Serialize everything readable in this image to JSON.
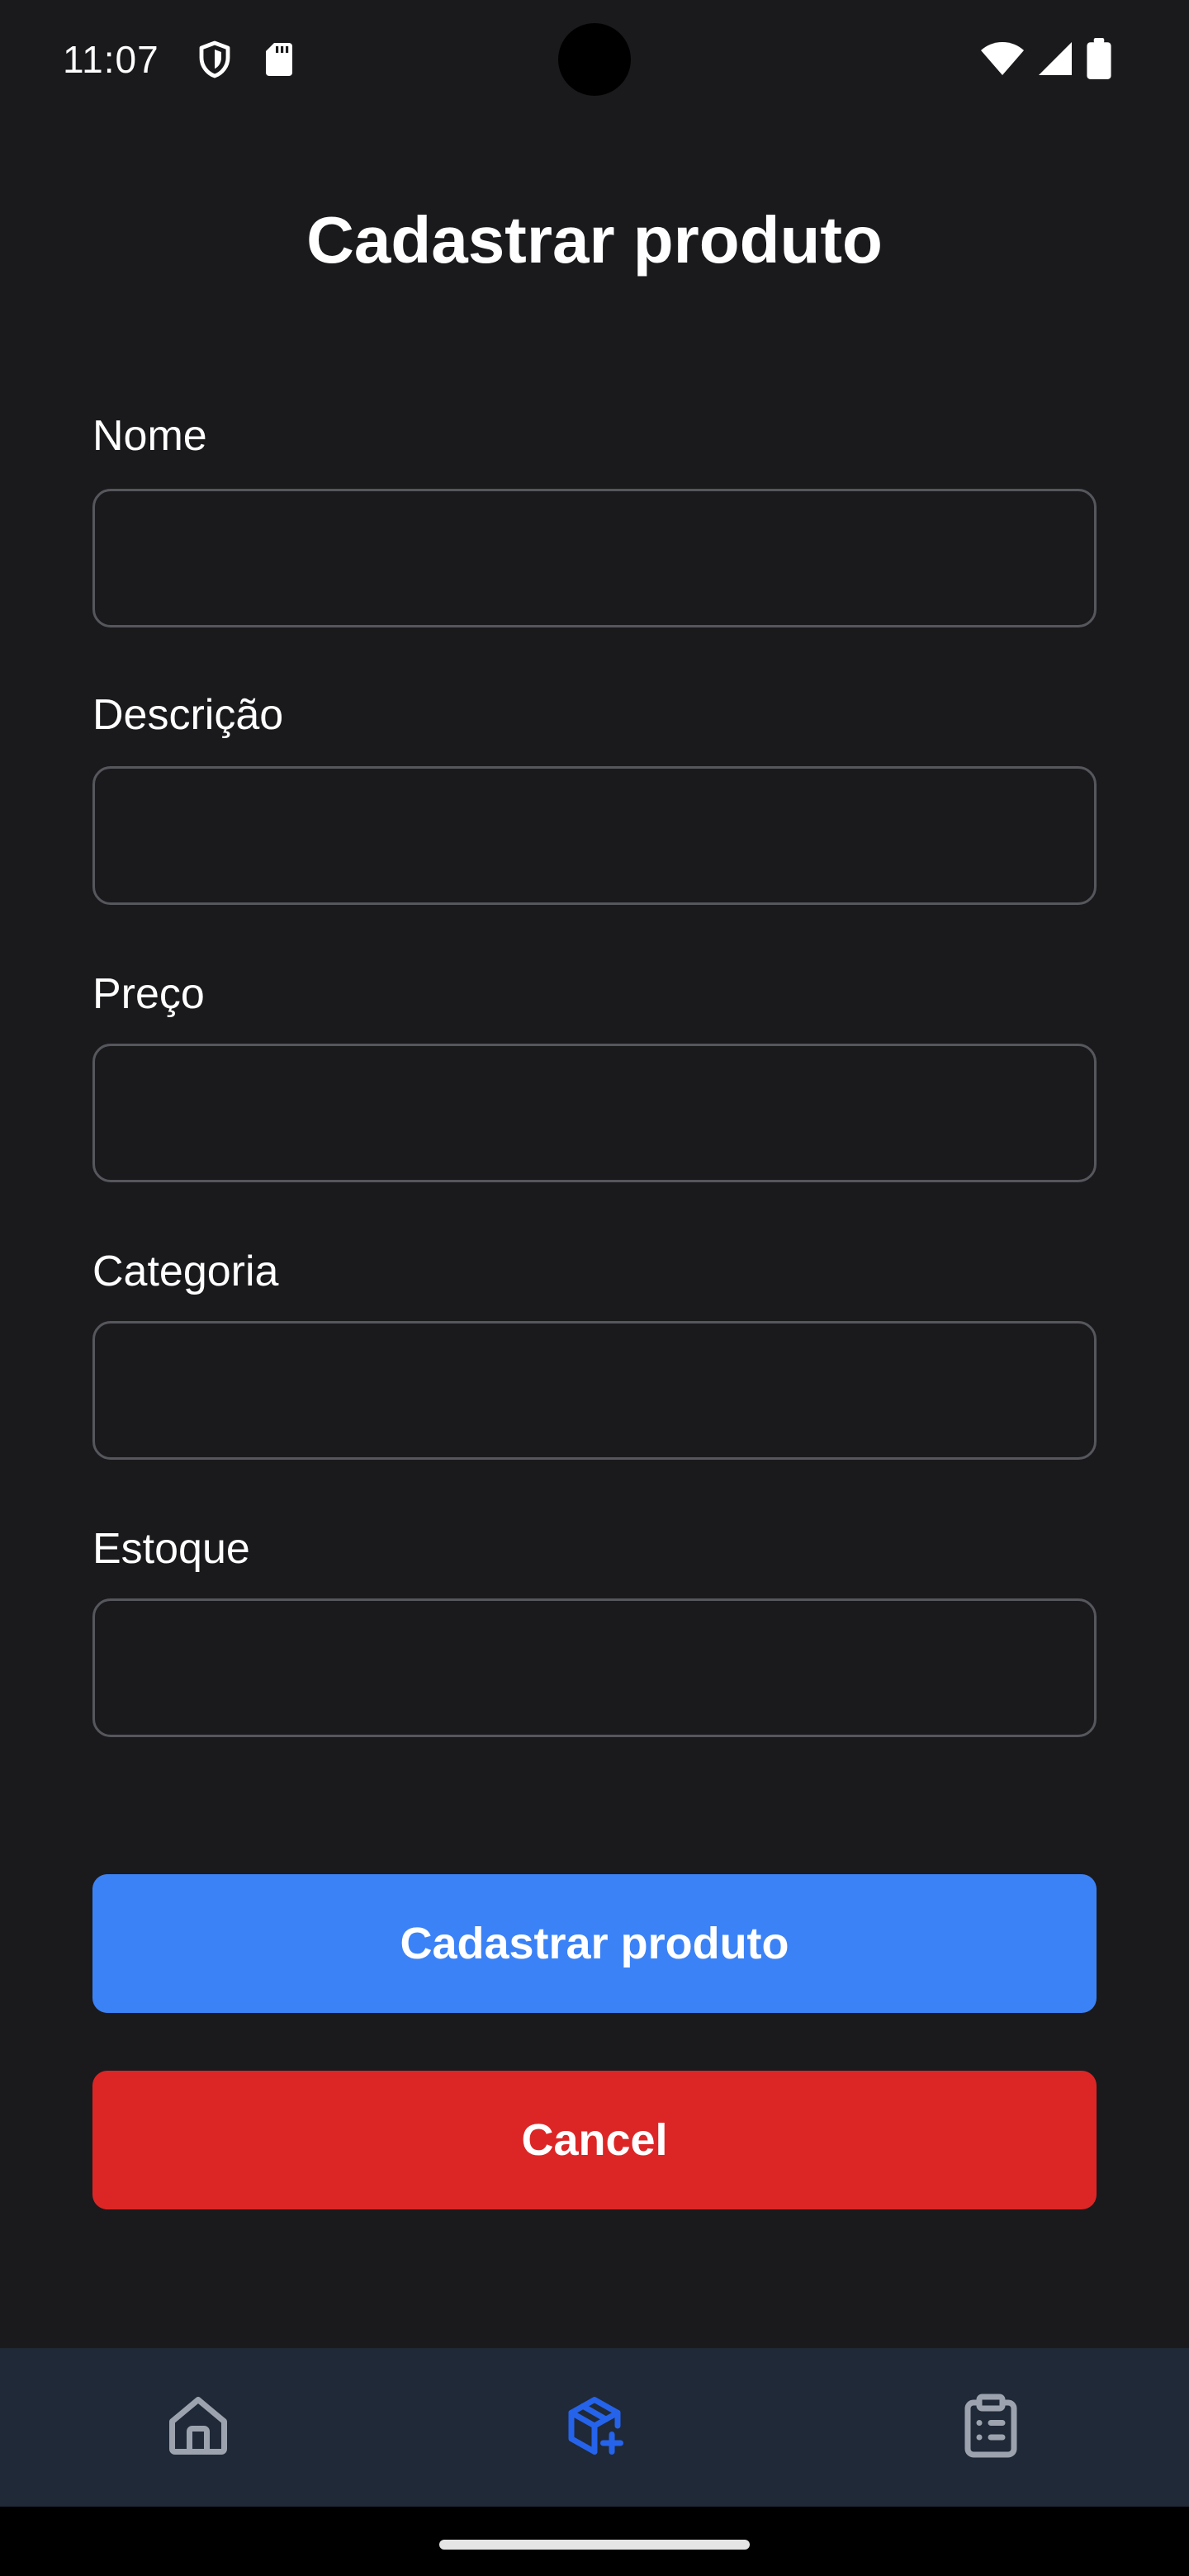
{
  "status_bar": {
    "time": "11:07",
    "icons": [
      "shield-icon",
      "sd-card-icon",
      "wifi-icon",
      "cellular-signal-icon",
      "battery-icon"
    ]
  },
  "page": {
    "title": "Cadastrar produto"
  },
  "form": {
    "fields": [
      {
        "label": "Nome",
        "value": ""
      },
      {
        "label": "Descrição",
        "value": ""
      },
      {
        "label": "Preço",
        "value": ""
      },
      {
        "label": "Categoria",
        "value": ""
      },
      {
        "label": "Estoque",
        "value": ""
      }
    ],
    "submit_label": "Cadastrar produto",
    "cancel_label": "Cancel"
  },
  "bottom_nav": {
    "items": [
      {
        "icon": "home-icon",
        "active": false
      },
      {
        "icon": "package-plus-icon",
        "active": true
      },
      {
        "icon": "clipboard-list-icon",
        "active": false
      }
    ],
    "active_color": "#2563eb",
    "inactive_color": "#9ca3af"
  },
  "colors": {
    "background": "#1a1a1d",
    "primary": "#3b82f6",
    "danger": "#dc2626",
    "nav_background": "#1f2937"
  }
}
